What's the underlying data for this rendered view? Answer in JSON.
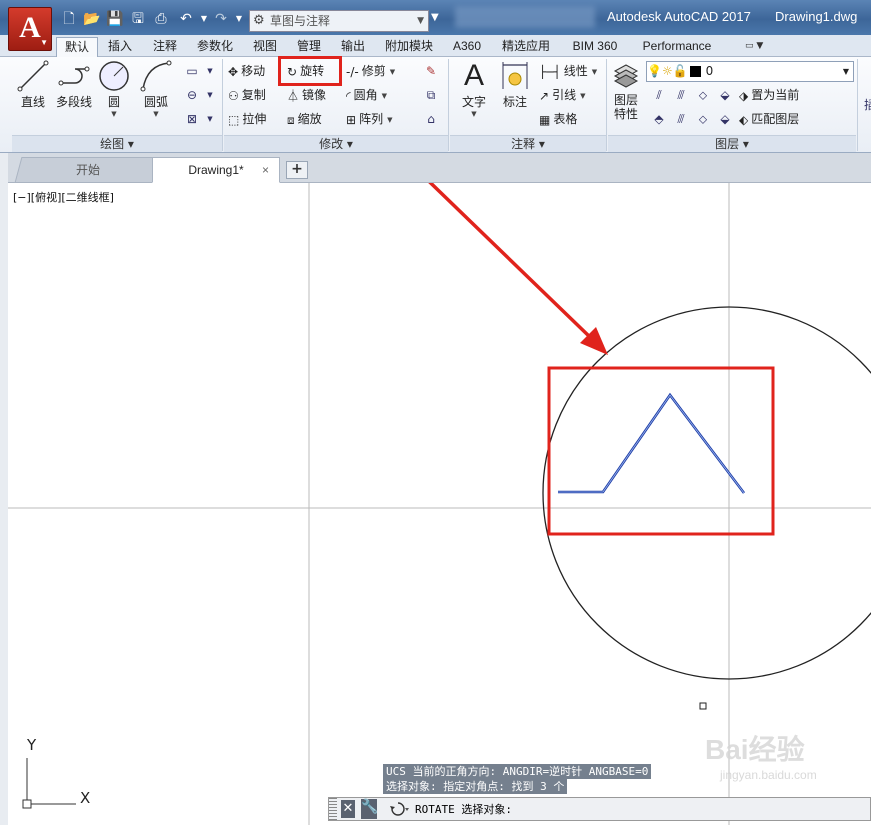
{
  "titlebar": {
    "app_logo": "A",
    "workspace": "草图与注释",
    "app_title": "Autodesk AutoCAD 2017",
    "doc_title": "Drawing1.dwg"
  },
  "ribbon_tabs": [
    "默认",
    "插入",
    "注释",
    "参数化",
    "视图",
    "管理",
    "输出",
    "附加模块",
    "A360",
    "精选应用",
    "BIM 360",
    "Performance"
  ],
  "active_tab": "默认",
  "panels": {
    "draw": {
      "title": "绘图",
      "line": "直线",
      "polyline": "多段线",
      "circle": "圆",
      "arc": "圆弧"
    },
    "modify": {
      "title": "修改",
      "move": "移动",
      "rotate": "旋转",
      "trim": "修剪",
      "copy": "复制",
      "mirror": "镜像",
      "fillet": "圆角",
      "stretch": "拉伸",
      "scale": "缩放",
      "array": "阵列"
    },
    "annotation": {
      "title": "注释",
      "text": "文字",
      "dimension": "标注",
      "linear": "线性",
      "leader": "引线",
      "table": "表格"
    },
    "layers": {
      "title": "图层",
      "properties_line1": "图层",
      "properties_line2": "特性",
      "current_layer": "0",
      "make_current": "置为当前",
      "match_layer": "匹配图层"
    }
  },
  "file_tabs": {
    "start": "开始",
    "drawing": "Drawing1*",
    "close": "×",
    "new": "+"
  },
  "viewport_label": "[−][俯视][二维线框]",
  "ucs": {
    "x": "X",
    "y": "Y"
  },
  "command": {
    "history": [
      "UCS 当前的正角方向:  ANGDIR=逆时针  ANGBASE=0",
      "选择对象: 指定对角点: 找到 3 个"
    ],
    "current": "ROTATE 选择对象:"
  },
  "watermark": {
    "logo": "Bai经验",
    "url": "jingyan.baidu.com"
  },
  "colors": {
    "highlight_red": "#e0231c",
    "selected_polyline": "#1f3fa8",
    "ribbon_bg": "#eef2f7"
  }
}
